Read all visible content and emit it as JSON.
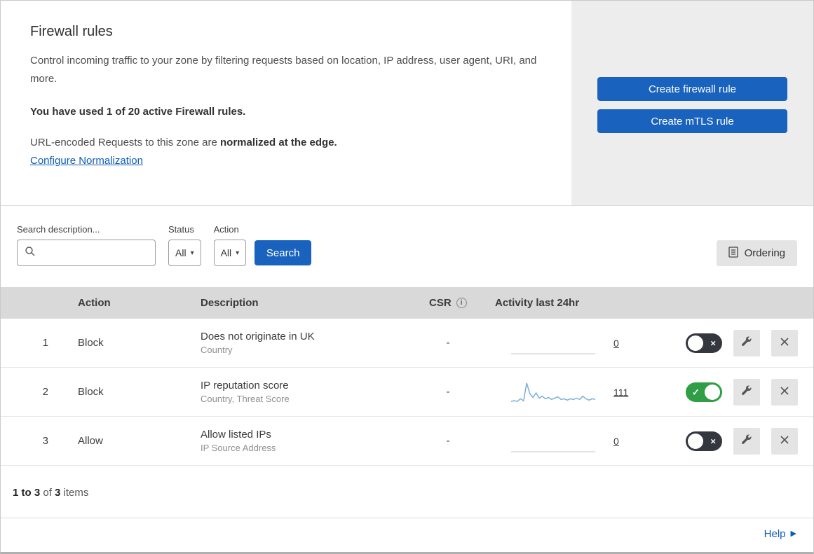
{
  "overview": {
    "title": "Firewall rules",
    "description": "Control incoming traffic to your zone by filtering requests based on location, IP address, user agent, URI, and more.",
    "usage": "You have used 1 of 20 active Firewall rules.",
    "normalization_prefix": "URL-encoded Requests to this zone are ",
    "normalization_bold": "normalized at the edge.",
    "normalization_link": "Configure Normalization",
    "buttons": {
      "create_firewall_rule": "Create firewall rule",
      "create_mtls_rule": "Create mTLS rule"
    }
  },
  "filters": {
    "search_label": "Search description...",
    "status_label": "Status",
    "status_value": "All",
    "action_label": "Action",
    "action_value": "All",
    "search_button": "Search",
    "ordering_button": "Ordering"
  },
  "table": {
    "columns": {
      "action": "Action",
      "description": "Description",
      "csr": "CSR",
      "activity": "Activity last 24hr"
    },
    "rows": [
      {
        "num": "1",
        "action": "Block",
        "description": "Does not originate in UK",
        "sub": "Country",
        "csr": "-",
        "activity": "0",
        "enabled": false,
        "sparkline": [
          0,
          0
        ]
      },
      {
        "num": "2",
        "action": "Block",
        "description": "IP reputation score",
        "sub": "Country, Threat Score",
        "csr": "-",
        "activity": "111",
        "enabled": true,
        "sparkline": [
          2,
          3,
          2,
          6,
          3,
          30,
          14,
          8,
          15,
          7,
          10,
          6,
          8,
          5,
          7,
          9,
          5,
          6,
          4,
          6,
          5,
          7,
          5,
          10,
          6,
          4,
          6,
          5
        ]
      },
      {
        "num": "3",
        "action": "Allow",
        "description": "Allow listed IPs",
        "sub": "IP Source Address",
        "csr": "-",
        "activity": "0",
        "enabled": false,
        "sparkline": [
          0,
          0
        ]
      }
    ]
  },
  "footer": {
    "range": "1 to 3",
    "of": " of ",
    "total": "3",
    "items": " items",
    "help": "Help"
  },
  "icons": {
    "toggle_on_mark": "✓",
    "toggle_off_mark": "×",
    "select_caret": "▾",
    "help_arrow": "▶",
    "info": "i"
  },
  "colors": {
    "primary_button": "#1962be",
    "link": "#0d5cb5",
    "toggle_on": "#2f9e44",
    "toggle_off": "#34383e",
    "sparkline": "#7aade0",
    "sparkline_flat": "#d9d9d9",
    "table_header_bg": "#d9d9d9",
    "panel_bg": "#ededed"
  }
}
